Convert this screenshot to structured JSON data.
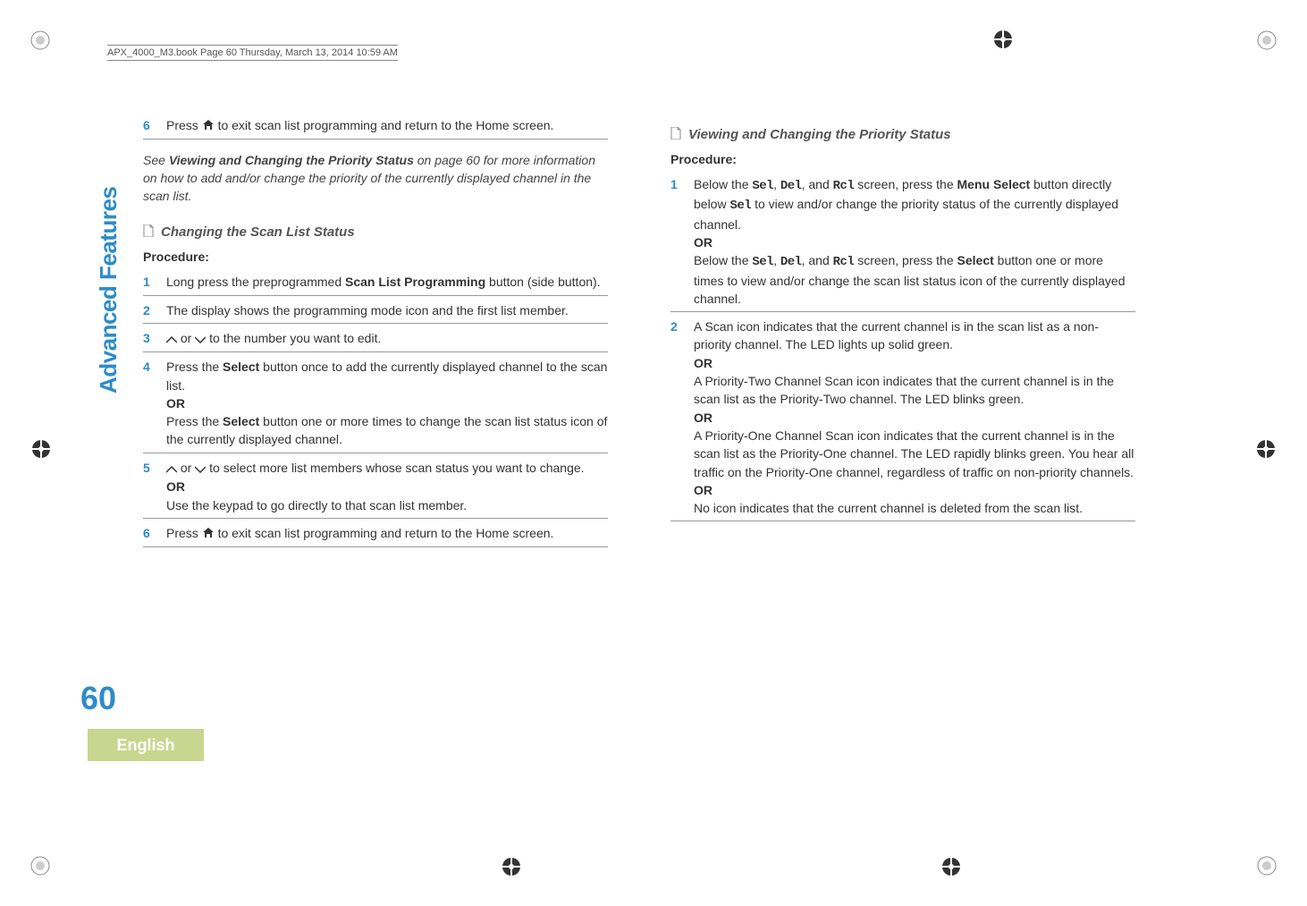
{
  "header": {
    "running_head": "APX_4000_M3.book  Page 60  Thursday, March 13, 2014  10:59 AM"
  },
  "left_col": {
    "step6_prefix": "Press ",
    "step6_suffix": " to exit scan list programming and return to the Home screen.",
    "note_line1": "See ",
    "note_bold": "Viewing and Changing the Priority Status",
    "note_line2": " on page 60 for more information on how to add and/or change the priority of the currently displayed channel in the scan list.",
    "subhead1": "Changing the Scan List Status",
    "procedure_label": "Procedure:",
    "s1a": "Long press the preprogrammed ",
    "s1b": "Scan List Programming",
    "s1c": " button (side button).",
    "s2": "The display shows the programming mode icon and the first list member.",
    "s3_mid": " or ",
    "s3_end": " to the number you want to edit.",
    "s4a": "Press the ",
    "s4b": "Select",
    "s4c": " button once to add the currently displayed channel to the scan list.",
    "or": "OR",
    "s4d": "Press the ",
    "s4e": "Select",
    "s4f": " button one or more times to change the scan list status icon of the currently displayed channel.",
    "s5_mid": " or ",
    "s5_end": " to select more list members whose scan status you want to change.",
    "s5_alt": "Use the keypad to go directly to that scan list member.",
    "s6_prefix": "Press ",
    "s6_suffix": " to exit scan list programming and return to the Home screen."
  },
  "right_col": {
    "subhead2": "Viewing and Changing the Priority Status",
    "procedure_label": "Procedure:",
    "s1_p1a": "Below the ",
    "sel": "Sel",
    "comma": ", ",
    "del": "Del",
    "and": ", and ",
    "rcl": "Rcl",
    "s1_p1b": " screen, press the ",
    "menu_select": "Menu Select",
    "s1_p1c": " button directly below ",
    "s1_p1d": " to view and/or change the priority status of the currently displayed channel.",
    "or": "OR",
    "s1_p2a": "Below the ",
    "s1_p2b": " screen, press the ",
    "select_btn": "Select",
    "s1_p2c": " button one or more times to view and/or change the scan list status icon of the currently displayed channel.",
    "s2_p1": "A Scan icon indicates that the current channel is in the scan list as a non-priority channel. The LED lights up solid green.",
    "s2_p2": "A Priority-Two Channel Scan icon indicates that the current channel is in the scan list as the Priority-Two channel. The LED blinks green.",
    "s2_p3": "A Priority-One Channel Scan icon indicates that the current channel is in the scan list as the Priority-One channel. The LED rapidly blinks green. You hear all traffic on the Priority-One channel, regardless of traffic on non-priority channels.",
    "s2_p4": "No icon indicates that the current channel is deleted from the scan list."
  },
  "sidebar": {
    "label": "Advanced Features"
  },
  "page": {
    "number": "60",
    "language": "English"
  },
  "nums": {
    "n1": "1",
    "n2": "2",
    "n3": "3",
    "n4": "4",
    "n5": "5",
    "n6": "6"
  }
}
